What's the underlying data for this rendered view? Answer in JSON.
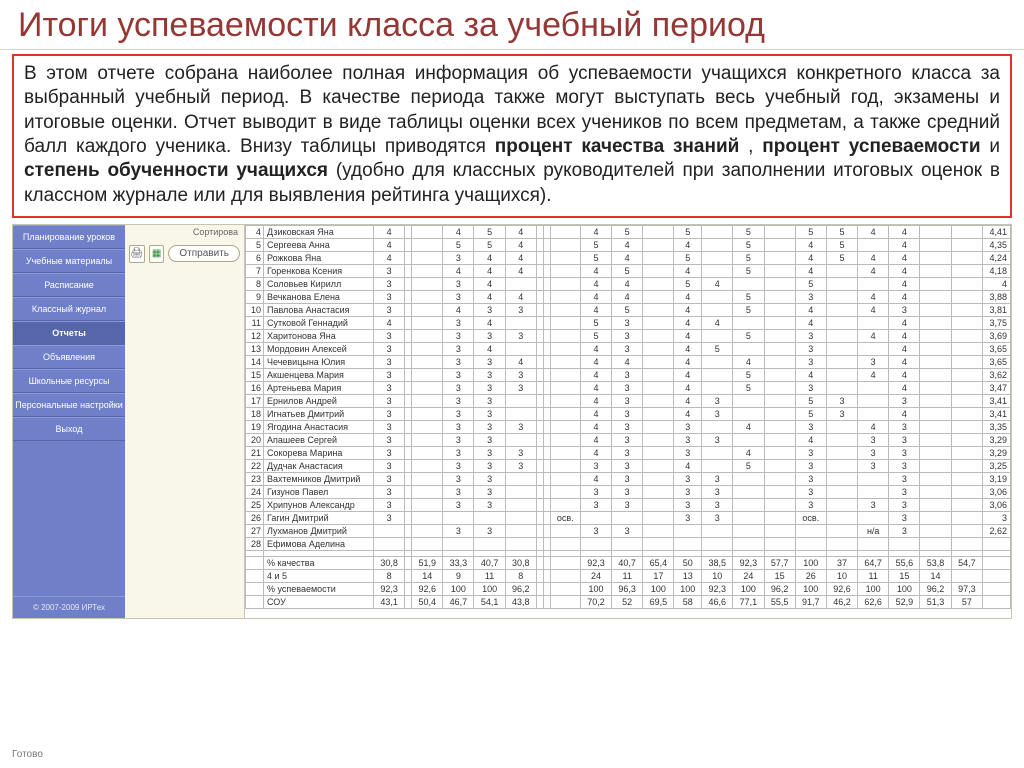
{
  "title": "Итоги успеваемости класса за учебный период",
  "description": {
    "p1": "В этом отчете собрана наиболее полная информация об успеваемости учащихся конкретного класса за выбранный учебный период. В качестве периода также могут выступать весь учебный год, экзамены и итоговые оценки. Отчет выводит в виде таблицы оценки всех учеников по всем предметам, а также средний балл каждого ученика. Внизу таблицы приводятся ",
    "b1": "процент качества знаний",
    "comma1": ", ",
    "b2": "процент успеваемости",
    "and": " и ",
    "b3": "степень обученности учащихся",
    "p2": " (удобно для классных руководителей при заполнении итоговых оценок в классном журнале или для выявления рейтинга учащихся)."
  },
  "sidebar": {
    "items": [
      "Планирование уроков",
      "Учебные материалы",
      "Расписание",
      "Классный журнал",
      "Отчеты",
      "Объявления",
      "Школьные ресурсы",
      "Персональные настройки",
      "Выход"
    ],
    "footer": "© 2007-2009 ИРТех"
  },
  "toolbar": {
    "sort_label": "Сортирова",
    "print_icon": "🖨",
    "excel_icon": "▦",
    "send_label": "Отправить"
  },
  "status": "Готово",
  "grades": {
    "rows": [
      {
        "n": 4,
        "name": "Дзиковская Яна",
        "c": [
          "4",
          "",
          "",
          "4",
          "5",
          "4",
          "",
          "",
          "",
          "4",
          "5",
          "",
          "5",
          "",
          "5",
          "",
          "5",
          "5",
          "4",
          "4"
        ],
        "avg": "4,41"
      },
      {
        "n": 5,
        "name": "Сергеева Анна",
        "c": [
          "4",
          "",
          "",
          "5",
          "5",
          "4",
          "",
          "",
          "",
          "5",
          "4",
          "",
          "4",
          "",
          "5",
          "",
          "4",
          "5",
          "",
          "4"
        ],
        "avg": "4,35"
      },
      {
        "n": 6,
        "name": "Рожкова Яна",
        "c": [
          "4",
          "",
          "",
          "3",
          "4",
          "4",
          "",
          "",
          "",
          "5",
          "4",
          "",
          "5",
          "",
          "5",
          "",
          "4",
          "5",
          "4",
          "4"
        ],
        "avg": "4,24"
      },
      {
        "n": 7,
        "name": "Горенкова Ксения",
        "c": [
          "3",
          "",
          "",
          "4",
          "4",
          "4",
          "",
          "",
          "",
          "4",
          "5",
          "",
          "4",
          "",
          "5",
          "",
          "4",
          "",
          "4",
          "4"
        ],
        "avg": "4,18"
      },
      {
        "n": 8,
        "name": "Соловьев Кирилл",
        "c": [
          "3",
          "",
          "",
          "3",
          "4",
          "",
          "",
          "",
          "",
          "4",
          "4",
          "",
          "5",
          "4",
          "",
          "",
          "5",
          "",
          "",
          "4"
        ],
        "avg": "4"
      },
      {
        "n": 9,
        "name": "Вечканова Елена",
        "c": [
          "3",
          "",
          "",
          "3",
          "4",
          "4",
          "",
          "",
          "",
          "4",
          "4",
          "",
          "4",
          "",
          "5",
          "",
          "3",
          "",
          "4",
          "4"
        ],
        "avg": "3,88"
      },
      {
        "n": 10,
        "name": "Павлова Анастасия",
        "c": [
          "3",
          "",
          "",
          "4",
          "3",
          "3",
          "",
          "",
          "",
          "4",
          "5",
          "",
          "4",
          "",
          "5",
          "",
          "4",
          "",
          "4",
          "3"
        ],
        "avg": "3,81"
      },
      {
        "n": 11,
        "name": "Сутковой Геннадий",
        "c": [
          "4",
          "",
          "",
          "3",
          "4",
          "",
          "",
          "",
          "",
          "5",
          "3",
          "",
          "4",
          "4",
          "",
          "",
          "4",
          "",
          "",
          "4"
        ],
        "avg": "3,75"
      },
      {
        "n": 12,
        "name": "Харитонова Яна",
        "c": [
          "3",
          "",
          "",
          "3",
          "3",
          "3",
          "",
          "",
          "",
          "5",
          "3",
          "",
          "4",
          "",
          "5",
          "",
          "3",
          "",
          "4",
          "4"
        ],
        "avg": "3,69"
      },
      {
        "n": 13,
        "name": "Мордовин Алексей",
        "c": [
          "3",
          "",
          "",
          "3",
          "4",
          "",
          "",
          "",
          "",
          "4",
          "3",
          "",
          "4",
          "5",
          "",
          "",
          "3",
          "",
          "",
          "4"
        ],
        "avg": "3,65"
      },
      {
        "n": 14,
        "name": "Чечевицына Юлия",
        "c": [
          "3",
          "",
          "",
          "3",
          "3",
          "4",
          "",
          "",
          "",
          "4",
          "4",
          "",
          "4",
          "",
          "4",
          "",
          "3",
          "",
          "3",
          "4"
        ],
        "avg": "3,65"
      },
      {
        "n": 15,
        "name": "Акшенцева Мария",
        "c": [
          "3",
          "",
          "",
          "3",
          "3",
          "3",
          "",
          "",
          "",
          "4",
          "3",
          "",
          "4",
          "",
          "5",
          "",
          "4",
          "",
          "4",
          "4"
        ],
        "avg": "3,62"
      },
      {
        "n": 16,
        "name": "Артеньева Мария",
        "c": [
          "3",
          "",
          "",
          "3",
          "3",
          "3",
          "",
          "",
          "",
          "4",
          "3",
          "",
          "4",
          "",
          "5",
          "",
          "3",
          "",
          "",
          "4"
        ],
        "avg": "3,47"
      },
      {
        "n": 17,
        "name": "Ернилов Андрей",
        "c": [
          "3",
          "",
          "",
          "3",
          "3",
          "",
          "",
          "",
          "",
          "4",
          "3",
          "",
          "4",
          "3",
          "",
          "",
          "5",
          "3",
          "",
          "3"
        ],
        "avg": "3,41"
      },
      {
        "n": 18,
        "name": "Игнатьев Дмитрий",
        "c": [
          "3",
          "",
          "",
          "3",
          "3",
          "",
          "",
          "",
          "",
          "4",
          "3",
          "",
          "4",
          "3",
          "",
          "",
          "5",
          "3",
          "",
          "4"
        ],
        "avg": "3,41"
      },
      {
        "n": 19,
        "name": "Ягодина Анастасия",
        "c": [
          "3",
          "",
          "",
          "3",
          "3",
          "3",
          "",
          "",
          "",
          "4",
          "3",
          "",
          "3",
          "",
          "4",
          "",
          "3",
          "",
          "4",
          "3"
        ],
        "avg": "3,35"
      },
      {
        "n": 20,
        "name": "Апашеев Сергей",
        "c": [
          "3",
          "",
          "",
          "3",
          "3",
          "",
          "",
          "",
          "",
          "4",
          "3",
          "",
          "3",
          "3",
          "",
          "",
          "4",
          "",
          "3",
          "3"
        ],
        "avg": "3,29"
      },
      {
        "n": 21,
        "name": "Сокорева Марина",
        "c": [
          "3",
          "",
          "",
          "3",
          "3",
          "3",
          "",
          "",
          "",
          "4",
          "3",
          "",
          "3",
          "",
          "4",
          "",
          "3",
          "",
          "3",
          "3"
        ],
        "avg": "3,29"
      },
      {
        "n": 22,
        "name": "Дудчак Анастасия",
        "c": [
          "3",
          "",
          "",
          "3",
          "3",
          "3",
          "",
          "",
          "",
          "3",
          "3",
          "",
          "4",
          "",
          "5",
          "",
          "3",
          "",
          "3",
          "3"
        ],
        "avg": "3,25"
      },
      {
        "n": 23,
        "name": "Вахтемников Дмитрий",
        "c": [
          "3",
          "",
          "",
          "3",
          "3",
          "",
          "",
          "",
          "",
          "4",
          "3",
          "",
          "3",
          "3",
          "",
          "",
          "3",
          "",
          "",
          "3"
        ],
        "avg": "3,19"
      },
      {
        "n": 24,
        "name": "Гизунов Павел",
        "c": [
          "3",
          "",
          "",
          "3",
          "3",
          "",
          "",
          "",
          "",
          "3",
          "3",
          "",
          "3",
          "3",
          "",
          "",
          "3",
          "",
          "",
          "3"
        ],
        "avg": "3,06"
      },
      {
        "n": 25,
        "name": "Хрипунов Александр",
        "c": [
          "3",
          "",
          "",
          "3",
          "3",
          "",
          "",
          "",
          "",
          "3",
          "3",
          "",
          "3",
          "3",
          "",
          "",
          "3",
          "",
          "3",
          "3"
        ],
        "avg": "3,06"
      },
      {
        "n": 26,
        "name": "Гагин Дмитрий",
        "c": [
          "3",
          "",
          "",
          "",
          "",
          "",
          "",
          "",
          "осв.",
          "",
          "",
          "",
          "3",
          "3",
          "",
          "",
          "осв.",
          "",
          "",
          "3"
        ],
        "avg": "3"
      },
      {
        "n": 27,
        "name": "Лухманов Дмитрий",
        "c": [
          "",
          "",
          "",
          "3",
          "3",
          "",
          "",
          "",
          "",
          "3",
          "3",
          "",
          "",
          "",
          "",
          "",
          "",
          "",
          "н/а",
          "3"
        ],
        "avg": "2,62"
      },
      {
        "n": 28,
        "name": "Ефимова Аделина",
        "c": [
          "",
          "",
          "",
          "",
          "",
          "",
          "",
          "",
          "",
          "",
          "",
          "",
          "",
          "",
          "",
          "",
          "",
          "",
          "",
          ""
        ],
        "avg": ""
      }
    ],
    "summary": [
      {
        "name": "% качества",
        "c": [
          "30,8",
          "",
          "51,9",
          "33,3",
          "40,7",
          "30,8",
          "",
          "",
          "",
          "92,3",
          "40,7",
          "65,4",
          "50",
          "38,5",
          "92,3",
          "57,7",
          "100",
          "37",
          "64,7",
          "55,6",
          "53,8",
          "54,7"
        ],
        "avg": ""
      },
      {
        "name": "4 и 5",
        "c": [
          "8",
          "",
          "14",
          "9",
          "11",
          "8",
          "",
          "",
          "",
          "24",
          "11",
          "17",
          "13",
          "10",
          "24",
          "15",
          "26",
          "10",
          "11",
          "15",
          "14",
          ""
        ],
        "avg": ""
      },
      {
        "name": "% успеваемости",
        "c": [
          "92,3",
          "",
          "92,6",
          "100",
          "100",
          "96,2",
          "",
          "",
          "",
          "100",
          "96,3",
          "100",
          "100",
          "92,3",
          "100",
          "96,2",
          "100",
          "92,6",
          "100",
          "100",
          "96,2",
          "97,3"
        ],
        "avg": ""
      },
      {
        "name": "СОУ",
        "c": [
          "43,1",
          "",
          "50,4",
          "46,7",
          "54,1",
          "43,8",
          "",
          "",
          "",
          "70,2",
          "52",
          "69,5",
          "58",
          "46,6",
          "77,1",
          "55,5",
          "91,7",
          "46,2",
          "62,6",
          "52,9",
          "51,3",
          "57"
        ],
        "avg": ""
      }
    ]
  }
}
